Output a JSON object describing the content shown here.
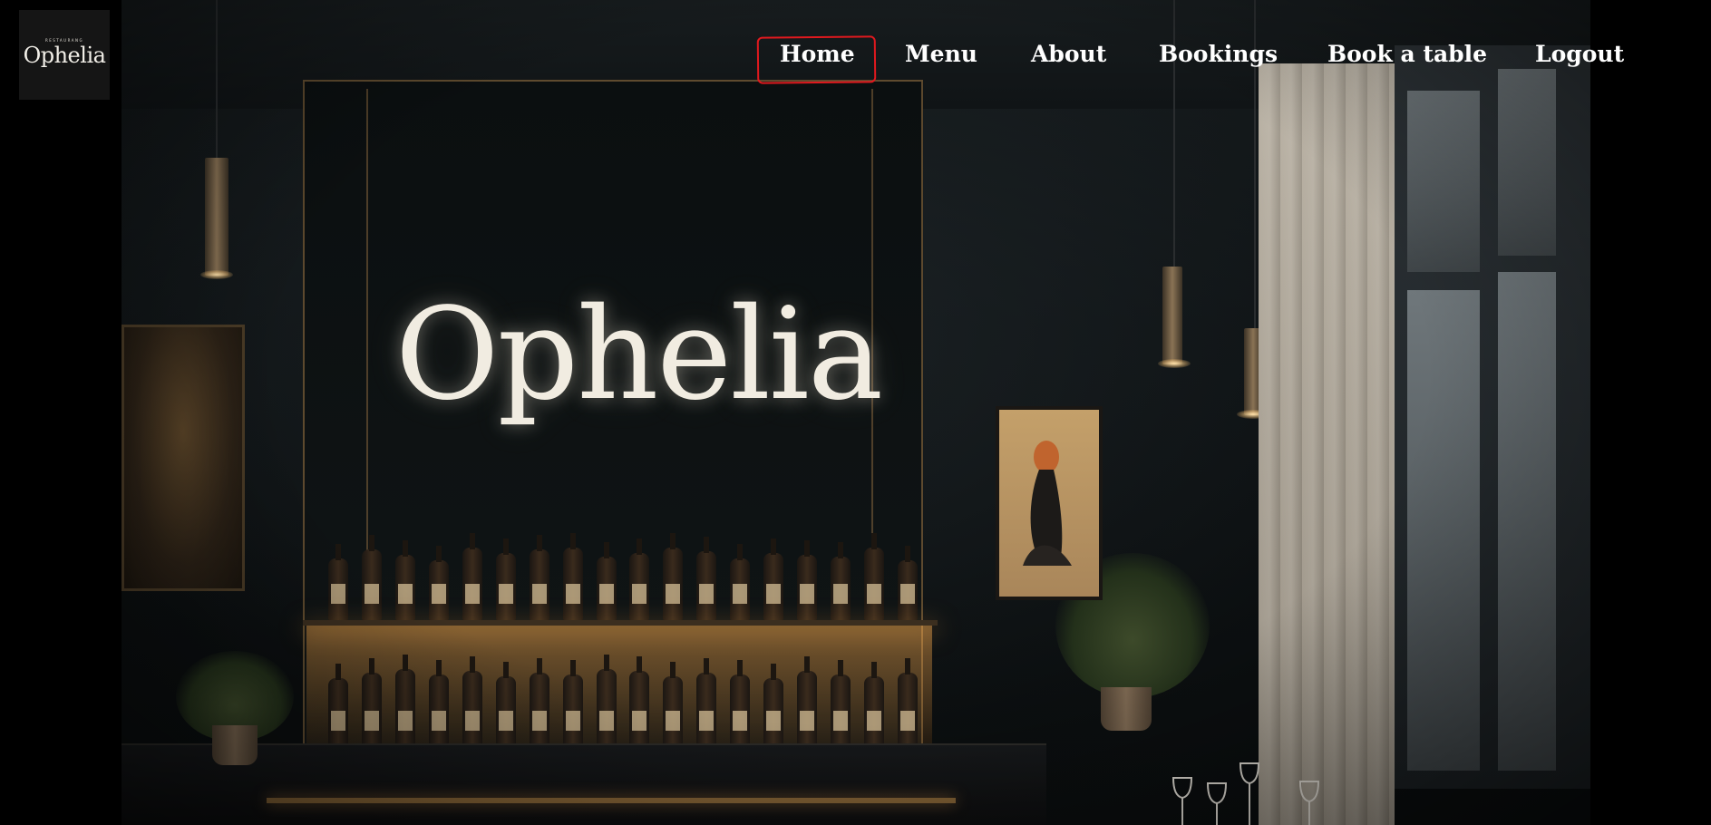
{
  "brand": {
    "logo_eyebrow": "RESTAURANG",
    "logo_name": "Ophelia",
    "wall_sign": "Ophelia"
  },
  "nav": {
    "items": [
      {
        "label": "Home",
        "active": true
      },
      {
        "label": "Menu",
        "active": false
      },
      {
        "label": "About",
        "active": false
      },
      {
        "label": "Bookings",
        "active": false
      },
      {
        "label": "Book a table",
        "active": false
      },
      {
        "label": "Logout",
        "active": false
      }
    ]
  },
  "colors": {
    "page_background": "#000000",
    "nav_text": "#ffffff",
    "active_outline": "#e0191e",
    "logo_background": "#151515",
    "wall_sign_glow": "#f1ece1",
    "bar_glow": "#ffaf50"
  },
  "hero": {
    "image_alt": "restaurant-interior-illustration"
  }
}
